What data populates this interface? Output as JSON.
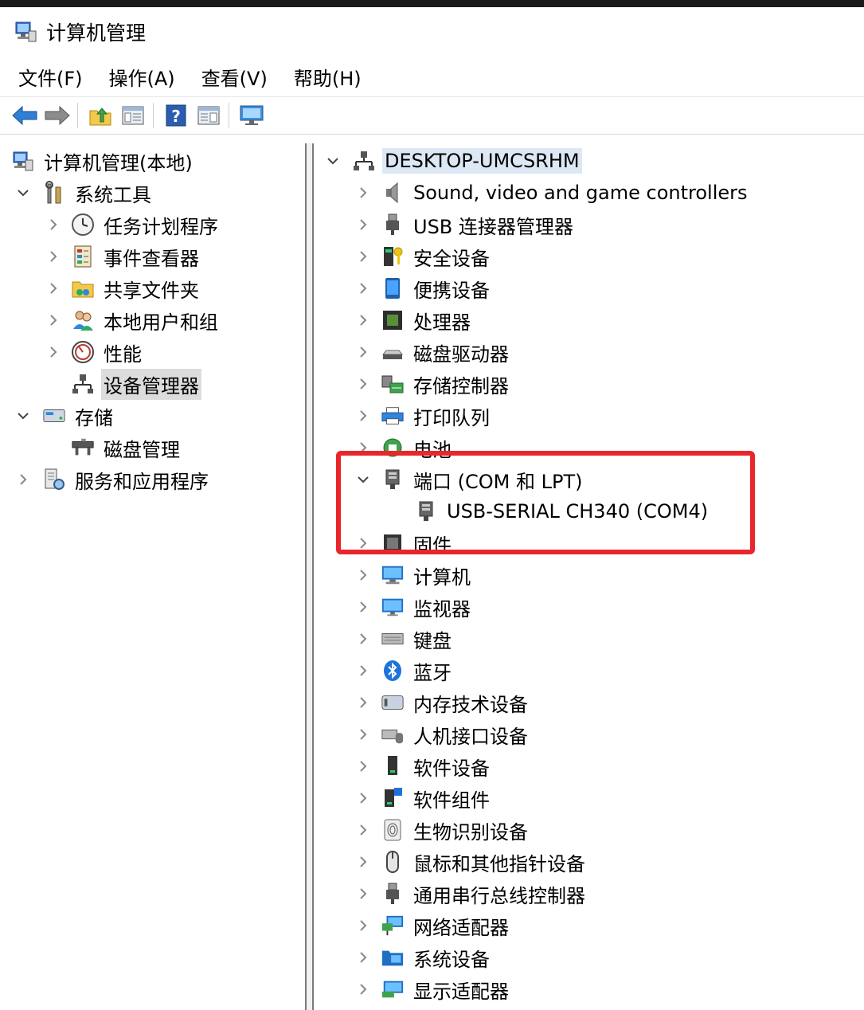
{
  "window": {
    "title": "计算机管理"
  },
  "menu": [
    "文件(F)",
    "操作(A)",
    "查看(V)",
    "帮助(H)"
  ],
  "toolbar": {
    "icons": [
      "back-arrow-icon",
      "forward-arrow-icon",
      "up-folder-icon",
      "show-hide-tree-icon",
      "help-icon",
      "properties-panel-icon",
      "monitor-icon"
    ]
  },
  "left_tree": [
    {
      "label": "计算机管理(本地)",
      "icon": "computer-management-icon",
      "level": 0,
      "expander": "none"
    },
    {
      "label": "系统工具",
      "icon": "system-tools-icon",
      "level": 0,
      "expander": "expanded"
    },
    {
      "label": "任务计划程序",
      "icon": "clock-icon",
      "level": 1,
      "expander": "collapsed"
    },
    {
      "label": "事件查看器",
      "icon": "event-viewer-icon",
      "level": 1,
      "expander": "collapsed"
    },
    {
      "label": "共享文件夹",
      "icon": "shared-folder-icon",
      "level": 1,
      "expander": "collapsed"
    },
    {
      "label": "本地用户和组",
      "icon": "users-icon",
      "level": 1,
      "expander": "collapsed"
    },
    {
      "label": "性能",
      "icon": "performance-icon",
      "level": 1,
      "expander": "collapsed"
    },
    {
      "label": "设备管理器",
      "icon": "device-manager-icon",
      "level": 1,
      "expander": "none",
      "selected": true
    },
    {
      "label": "存储",
      "icon": "storage-icon",
      "level": 0,
      "expander": "expanded"
    },
    {
      "label": "磁盘管理",
      "icon": "disk-management-icon",
      "level": 1,
      "expander": "none"
    },
    {
      "label": "服务和应用程序",
      "icon": "services-icon",
      "level": 0,
      "expander": "collapsed"
    }
  ],
  "right_tree": {
    "root": {
      "label": "DESKTOP-UMCSRHM",
      "icon": "computer-root-icon"
    },
    "items": [
      {
        "label": "Sound, video and game controllers",
        "icon": "speaker-icon"
      },
      {
        "label": "USB 连接器管理器",
        "icon": "usb-plug-icon"
      },
      {
        "label": "安全设备",
        "icon": "security-key-icon"
      },
      {
        "label": "便携设备",
        "icon": "portable-device-icon"
      },
      {
        "label": "处理器",
        "icon": "processor-icon"
      },
      {
        "label": "磁盘驱动器",
        "icon": "disk-drive-icon"
      },
      {
        "label": "存储控制器",
        "icon": "storage-controller-icon"
      },
      {
        "label": "打印队列",
        "icon": "printer-icon"
      },
      {
        "label": "电池",
        "icon": "battery-icon"
      },
      {
        "label": "端口 (COM 和 LPT)",
        "icon": "port-icon",
        "expanded": true
      },
      {
        "label": "USB-SERIAL CH340 (COM4)",
        "icon": "port-icon",
        "child": true
      },
      {
        "label": "固件",
        "icon": "firmware-icon"
      },
      {
        "label": "计算机",
        "icon": "computer-icon"
      },
      {
        "label": "监视器",
        "icon": "monitor-icon"
      },
      {
        "label": "键盘",
        "icon": "keyboard-icon"
      },
      {
        "label": "蓝牙",
        "icon": "bluetooth-icon"
      },
      {
        "label": "内存技术设备",
        "icon": "memory-icon"
      },
      {
        "label": "人机接口设备",
        "icon": "hid-icon"
      },
      {
        "label": "软件设备",
        "icon": "software-device-icon"
      },
      {
        "label": "软件组件",
        "icon": "software-component-icon"
      },
      {
        "label": "生物识别设备",
        "icon": "fingerprint-icon"
      },
      {
        "label": "鼠标和其他指针设备",
        "icon": "mouse-icon"
      },
      {
        "label": "通用串行总线控制器",
        "icon": "usb-controller-icon"
      },
      {
        "label": "网络适配器",
        "icon": "network-adapter-icon"
      },
      {
        "label": "系统设备",
        "icon": "system-device-icon"
      },
      {
        "label": "显示适配器",
        "icon": "display-adapter-icon"
      }
    ]
  },
  "colors": {
    "highlight_box": "#e8262b",
    "selection": "#dcdcdc",
    "root_selection": "#dde8f5"
  }
}
